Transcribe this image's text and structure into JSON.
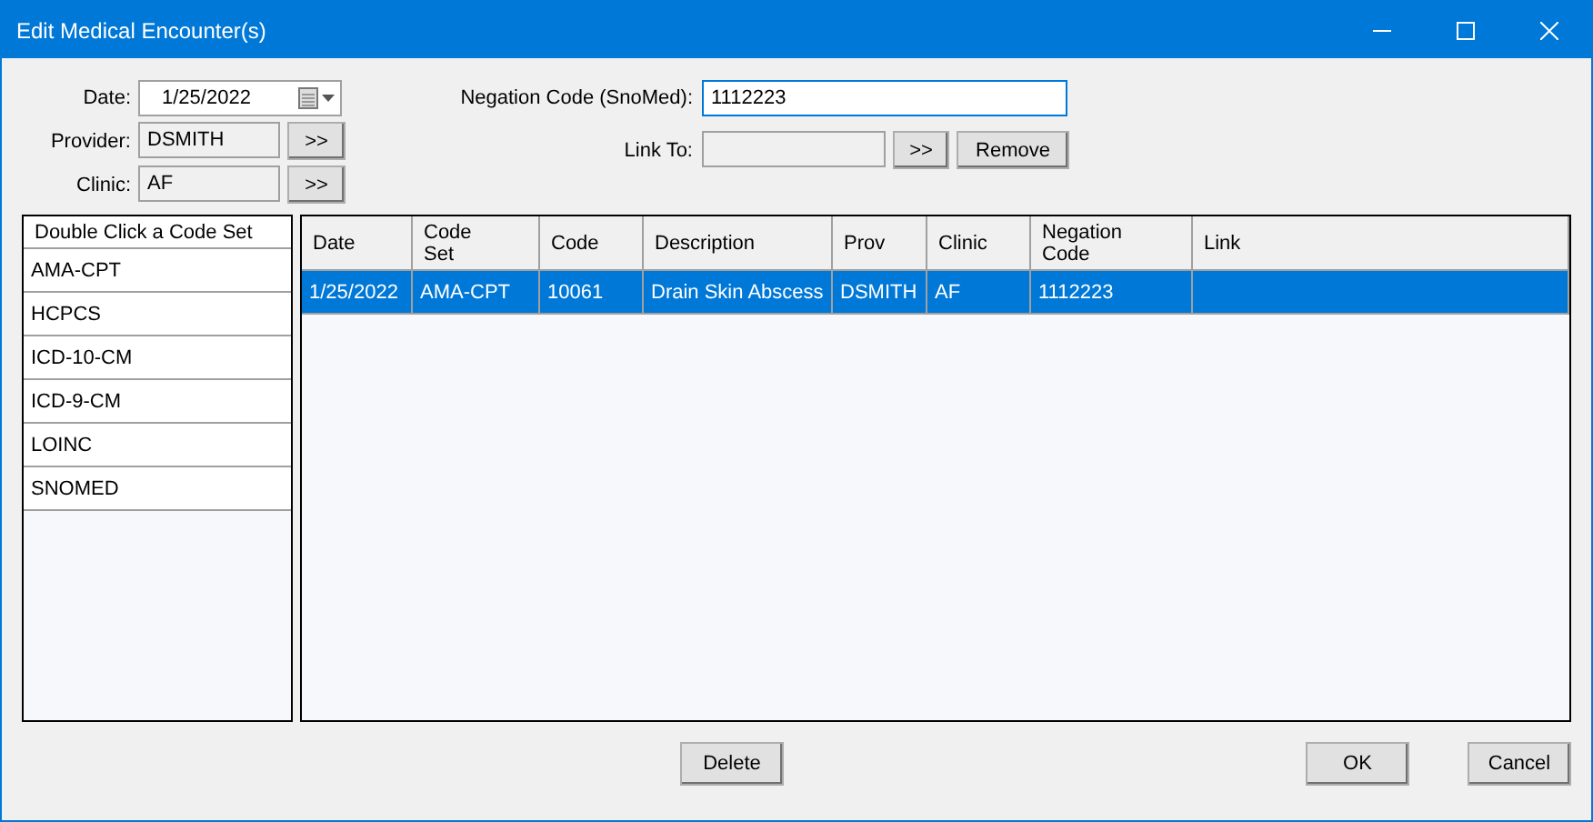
{
  "window": {
    "title": "Edit Medical Encounter(s)"
  },
  "form": {
    "date": {
      "label": "Date:",
      "value": "1/25/2022"
    },
    "provider": {
      "label": "Provider:",
      "value": "DSMITH",
      "disabled": true,
      "button": ">>"
    },
    "clinic": {
      "label": "Clinic:",
      "value": "AF",
      "disabled": true,
      "button": ">>"
    },
    "negation": {
      "label": "Negation Code (SnoMed):",
      "value": "1112223",
      "disabled": false
    },
    "link": {
      "label": "Link To:",
      "disabled": true,
      "button": ">>",
      "remove": "Remove"
    }
  },
  "code_sets": {
    "header": "Double Click a Code Set",
    "items": [
      {
        "label": "AMA-CPT",
        "selected": false
      },
      {
        "label": "HCPCS",
        "selected": false
      },
      {
        "label": "ICD-10-CM",
        "selected": false
      },
      {
        "label": "ICD-9-CM",
        "selected": false
      },
      {
        "label": "LOINC",
        "selected": false
      },
      {
        "label": "SNOMED",
        "selected": false
      }
    ]
  },
  "table": {
    "columns": [
      "Date",
      "Code Set",
      "Code",
      "Description",
      "Prov",
      "Clinic",
      "Negation Code",
      "Link"
    ],
    "rows": [
      {
        "cells": [
          "1/25/2022",
          "AMA-CPT",
          "10061",
          "Drain Skin Abscess",
          "DSMITH",
          "AF",
          "1112223",
          ""
        ],
        "selected": true
      }
    ]
  },
  "buttons": {
    "delete": "Delete",
    "ok": "OK",
    "cancel": "Cancel"
  }
}
